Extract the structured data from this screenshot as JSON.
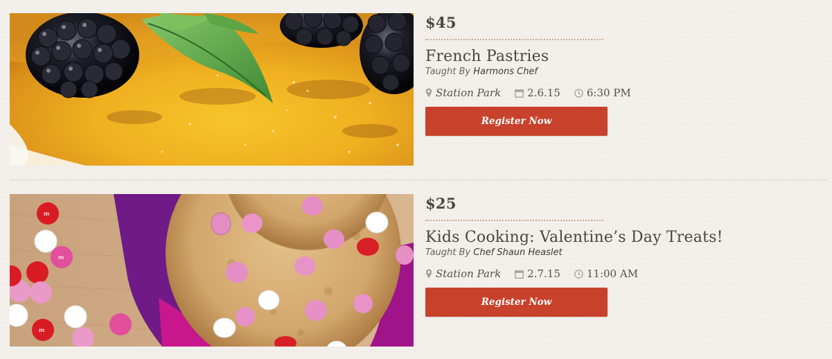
{
  "classes": [
    {
      "price": "$45",
      "title": "French Pastries",
      "taught_prefix": "Taught By",
      "chef": "Harmons Chef",
      "location": "Station Park",
      "date": "2.6.15",
      "time": "6:30 PM",
      "button_label": "Register Now",
      "image_icon": "creme-brulee-with-blackberries-photo"
    },
    {
      "price": "$25",
      "title": "Kids Cooking: Valentine’s Day Treats!",
      "taught_prefix": "Taught By",
      "chef": "Chef Shaun Heaslet",
      "location": "Station Park",
      "date": "2.7.15",
      "time": "11:00 AM",
      "button_label": "Register Now",
      "image_icon": "valentine-cookies-photo"
    }
  ],
  "colors": {
    "accent_button": "#c8412b",
    "divider_dotted": "#c9ad91",
    "background": "#f3efea",
    "text": "#4a4540"
  },
  "icons": {
    "location": "map-pin-icon",
    "date": "calendar-icon",
    "time": "clock-icon"
  }
}
